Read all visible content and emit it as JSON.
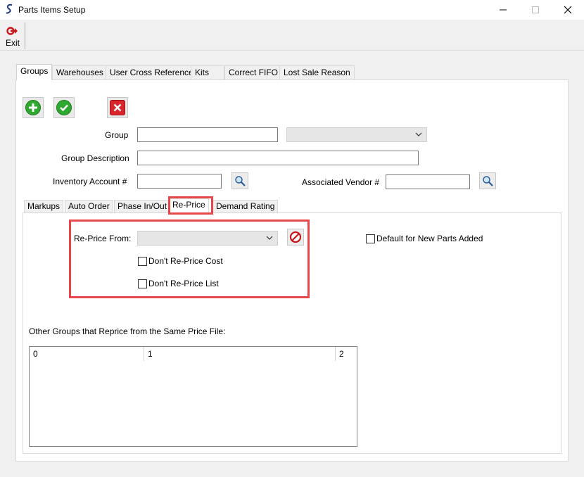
{
  "window": {
    "title": "Parts Items Setup",
    "app_icon": "spectrum-s-icon"
  },
  "toolbar": {
    "exit_label": "Exit"
  },
  "tabs": [
    {
      "label": "Groups",
      "active": true
    },
    {
      "label": "Warehouses"
    },
    {
      "label": "User Cross Reference"
    },
    {
      "label": "Kits"
    },
    {
      "label": "Correct FIFO"
    },
    {
      "label": "Lost Sale Reason"
    }
  ],
  "form": {
    "group_label": "Group",
    "group_value": "",
    "group_combo_value": "",
    "group_description_label": "Group Description",
    "group_description_value": "",
    "inventory_account_label": "Inventory Account #",
    "inventory_account_value": "",
    "associated_vendor_label": "Associated Vendor #",
    "associated_vendor_value": ""
  },
  "subtabs": [
    {
      "label": "Markups"
    },
    {
      "label": "Auto Order"
    },
    {
      "label": "Phase In/Out"
    },
    {
      "label": "Re-Price",
      "active": true
    },
    {
      "label": "Demand Rating"
    }
  ],
  "reprice": {
    "reprice_from_label": "Re-Price From:",
    "reprice_from_value": "",
    "dont_reprice_cost_label": "Don't Re-Price Cost",
    "dont_reprice_cost_checked": false,
    "dont_reprice_list_label": "Don't Re-Price List",
    "dont_reprice_list_checked": false,
    "default_new_parts_label": "Default for New Parts Added",
    "default_new_parts_checked": false,
    "other_groups_label": "Other Groups that Reprice from the Same Price File:",
    "grid_columns": [
      "0",
      "1",
      "2"
    ]
  },
  "colors": {
    "highlight": "#e8474a",
    "add_green": "#2fa82f",
    "delete_red": "#d9262c"
  }
}
